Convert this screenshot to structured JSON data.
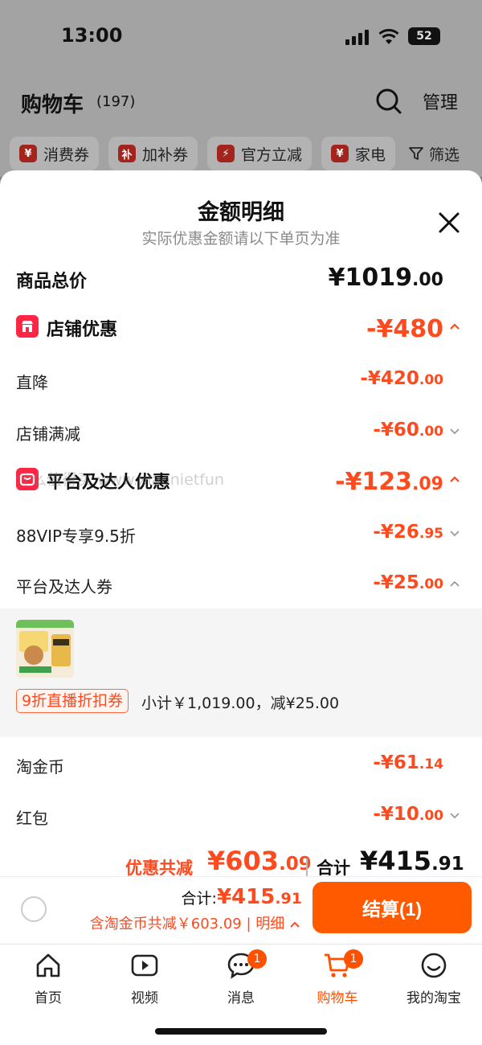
{
  "status": {
    "time": "13:00",
    "battery": "52"
  },
  "header": {
    "title": "购物车",
    "count": "(197)",
    "manage": "管理"
  },
  "chips": [
    {
      "icon": "¥",
      "label": "消费券"
    },
    {
      "icon": "补",
      "label": "加补券"
    },
    {
      "icon": "⚡",
      "label": "官方立减"
    },
    {
      "icon": "¥",
      "label": "家电"
    }
  ],
  "filter": {
    "label": "筛选"
  },
  "sheet": {
    "title": "金额明细",
    "subtitle": "实际优惠金额请以下单页为准",
    "total_label": "商品总价",
    "total_main": "¥1019",
    "total_dec": ".00",
    "shop_label": "店铺优惠",
    "shop_value": "-¥480",
    "direct_label": "直降",
    "direct_main": "-¥420",
    "direct_dec": ".00",
    "shop_full_label": "店铺满减",
    "shop_full_main": "-¥60",
    "shop_full_dec": ".00",
    "platform_label": "平台及达人优惠",
    "platform_main": "-¥123",
    "platform_dec": ".09",
    "vip_label": "88VIP专享9.5折",
    "vip_main": "-¥26",
    "vip_dec": ".95",
    "coupon_label": "平台及达人券",
    "coupon_main": "-¥25",
    "coupon_dec": ".00",
    "coupon_tag": "9折直播折扣券",
    "coupon_desc": "小计￥1,019.00，减¥25.00",
    "watermark": "什么值得买 www.xiaonietfun",
    "taojinbi_label": "淘金币",
    "taojinbi_main": "-¥61",
    "taojinbi_dec": ".14",
    "hongbao_label": "红包",
    "hongbao_main": "-¥10",
    "hongbao_dec": ".00",
    "discount_label": "优惠共减",
    "discount_main": "¥603",
    "discount_dec": ".09",
    "sum_label": "合计",
    "sum_main": "¥415",
    "sum_dec": ".91"
  },
  "checkout": {
    "total_label": "合计:",
    "total_main": "¥415",
    "total_dec": ".91",
    "detail": "含淘金币共减￥603.09 | 明细",
    "pay_button": "结算(1)"
  },
  "tabs": [
    {
      "label": "首页",
      "icon": "home-icon"
    },
    {
      "label": "视频",
      "icon": "video-icon"
    },
    {
      "label": "消息",
      "icon": "message-icon",
      "badge": "1"
    },
    {
      "label": "购物车",
      "icon": "cart-icon",
      "badge": "1",
      "active": true
    },
    {
      "label": "我的淘宝",
      "icon": "profile-icon"
    }
  ],
  "colors": {
    "accent": "#ff5000",
    "discount": "#ff4a1e",
    "shop_icon": "#ff2545"
  }
}
